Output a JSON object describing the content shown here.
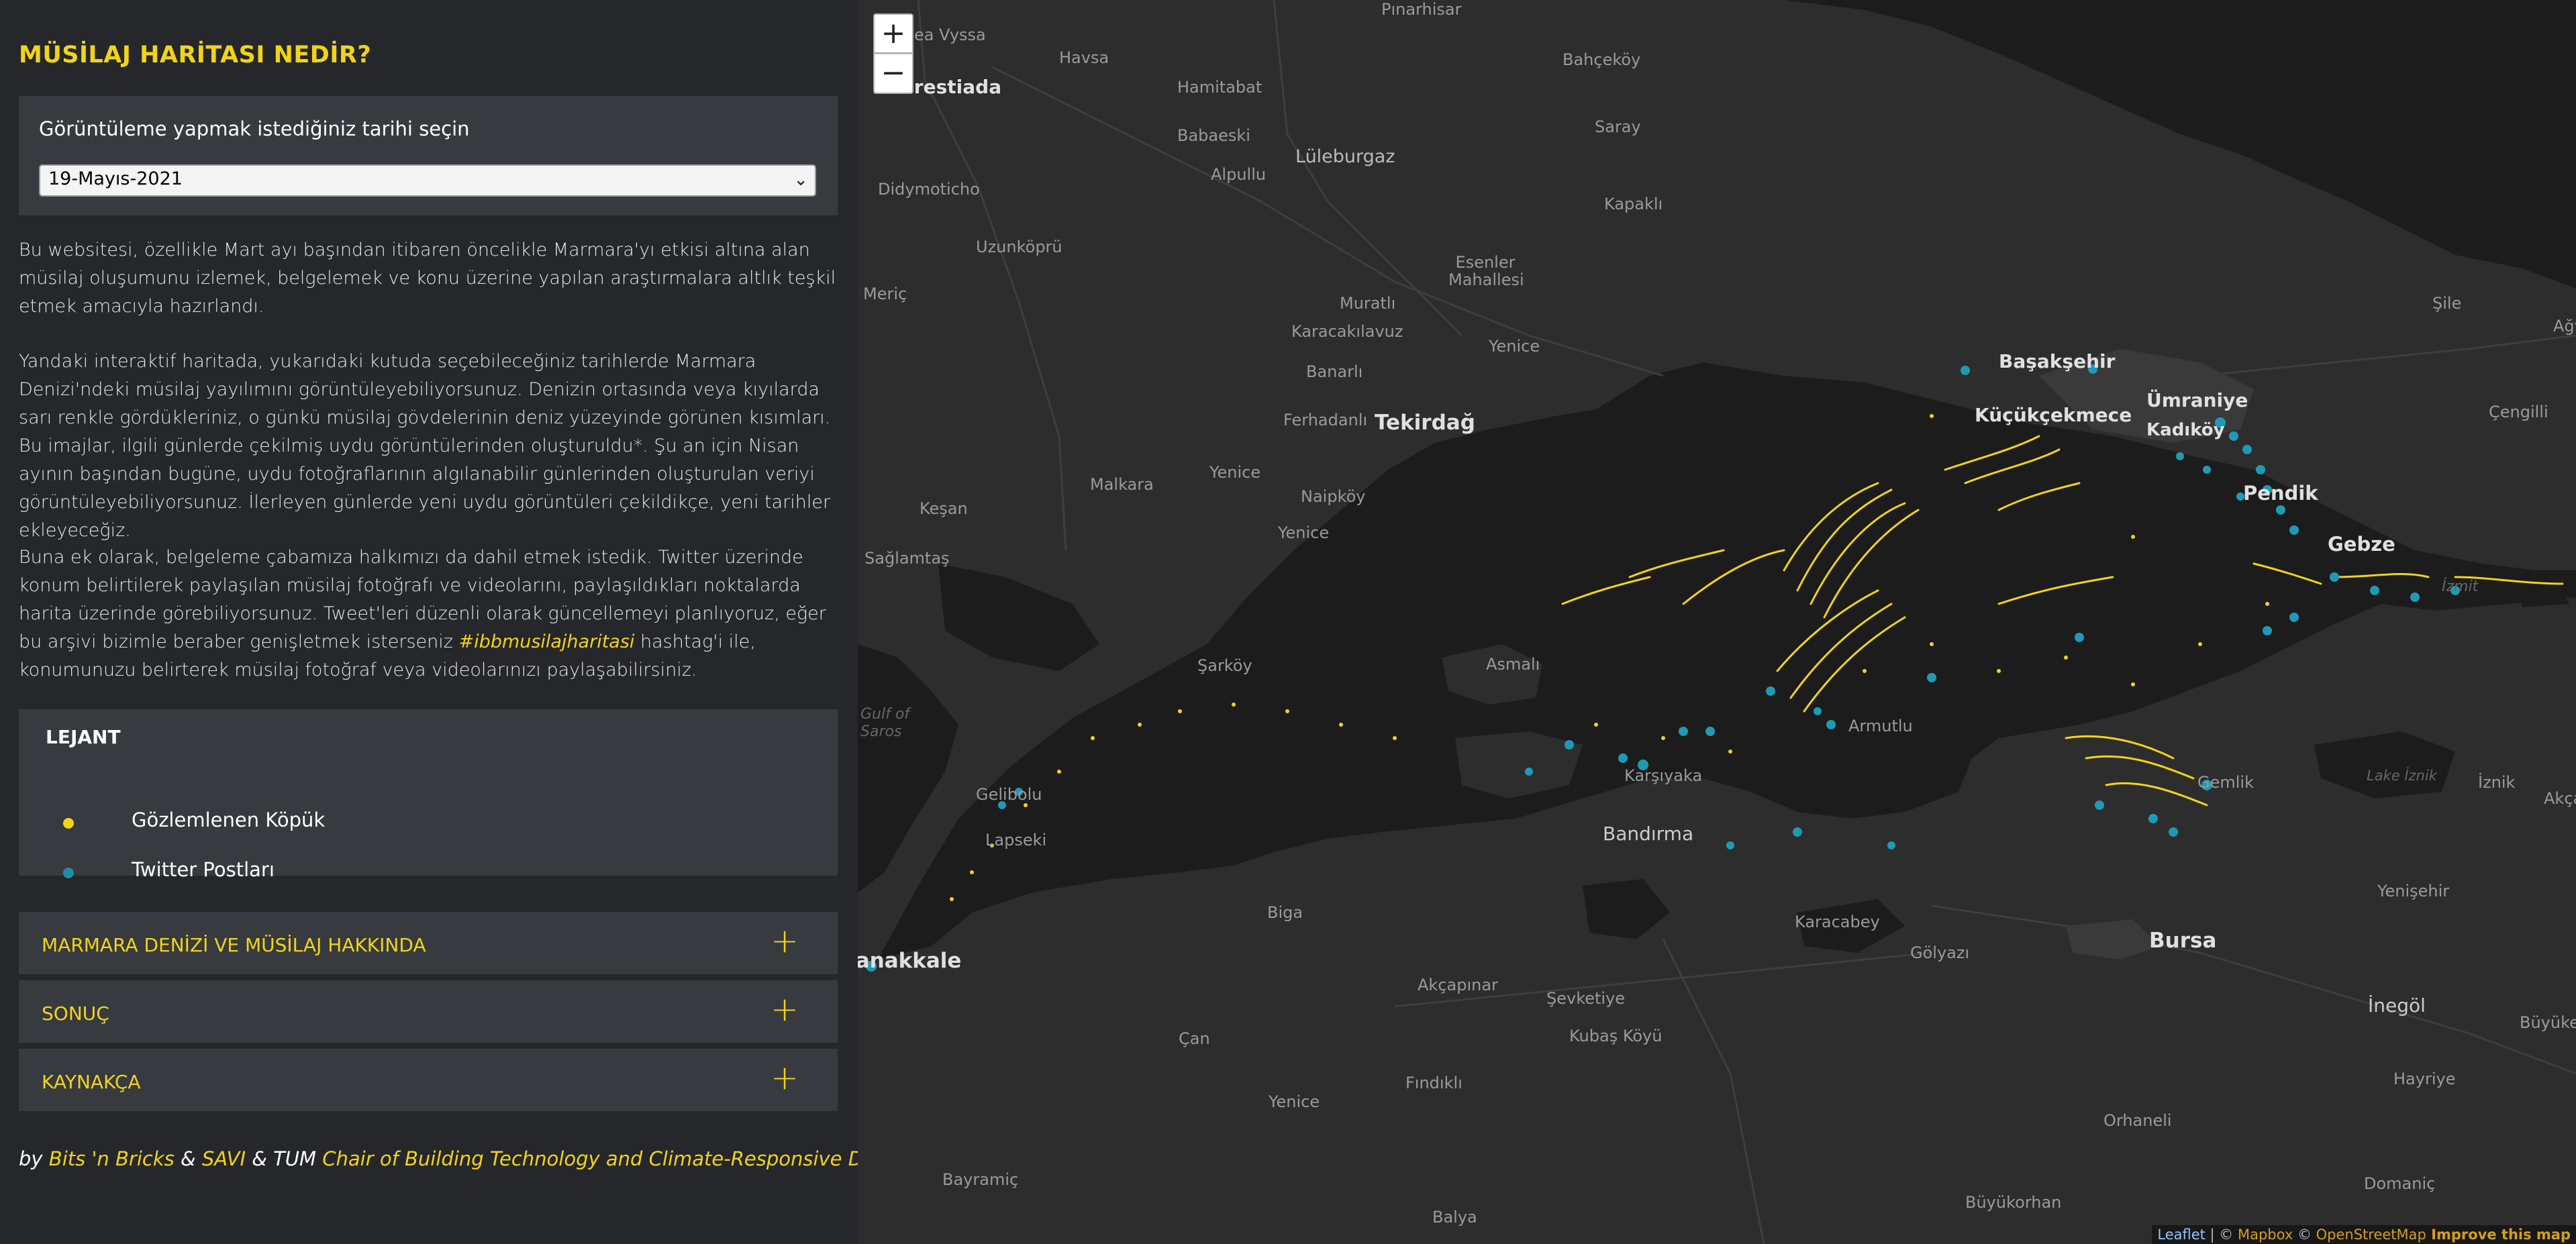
{
  "sidebar": {
    "title": "MÜSİLAJ HARİTASI NEDİR?",
    "date_prompt": "Görüntüleme yapmak istediğiniz tarihi seçin",
    "date_selected": "19-Mayıs-2021",
    "intro_1": "Bu websitesi, özellikle Mart ayı başından itibaren öncelikle Marmara'yı etkisi altına alan müsilaj oluşumunu izlemek, belgelemek ve konu üzerine yapılan araştırmalara altlık teşkil etmek amacıyla hazırlandı.",
    "intro_2": "Yandaki interaktif haritada, yukarıdaki kutuda seçebileceğiniz tarihlerde Marmara Denizi'ndeki müsilaj yayılımını görüntüleyebiliyorsunuz. Denizin ortasında veya kıyılarda sarı renkle gördükleriniz, o günkü müsilaj gövdelerinin deniz yüzeyinde görünen kısımları. Bu imajlar, ilgili günlerde çekilmiş uydu görüntülerinden oluşturuldu*. Şu an için Nisan ayının başından bugüne, uydu fotoğraflarının algılanabilir günlerinden oluşturulan veriyi görüntüleyebiliyorsunuz. İlerleyen günlerde yeni uydu görüntüleri çekildikçe, yeni tarihler ekleyeceğiz.",
    "intro_3_a": "Buna ek olarak, belgeleme çabamıza halkımızı da dahil etmek istedik. Twitter üzerinde konum belirtilerek paylaşılan müsilaj fotoğrafı ve videolarını, paylaşıldıkları noktalarda harita üzerinde görebiliyorsunuz. Tweet'leri düzenli olarak güncellemeyi planlıyoruz, eğer bu arşivi bizimle beraber genişletmek isterseniz ",
    "intro_3_hashtag": "#ibbmusilajharitasi",
    "intro_3_b": " hashtag'i ile, konumunuzu belirterek müsilaj fotoğraf veya videolarınızı paylaşabilirsiniz.",
    "legend": {
      "title": "LEJANT",
      "items": [
        {
          "label": "Gözlemlenen Köpük",
          "color": "#f2d417"
        },
        {
          "label": "Twitter Postları",
          "color": "#1f8fa8"
        }
      ]
    },
    "accordion": [
      {
        "label": "MARMARA DENİZİ VE MÜSİLAJ HAKKINDA",
        "icon": "plus-icon"
      },
      {
        "label": "SONUÇ",
        "icon": "plus-icon"
      },
      {
        "label": "KAYNAKÇA",
        "icon": "plus-icon"
      }
    ],
    "byline": {
      "by": "by ",
      "org1": "Bits 'n Bricks",
      "amp1": " & ",
      "org2": "SAVI",
      "amp2": " & TUM ",
      "org3": "Chair of Building Technology and Climate-Responsive Design"
    }
  },
  "map": {
    "zoom_in": "+",
    "zoom_out": "−",
    "attribution": {
      "leaflet": "Leaflet",
      "sep": " | © ",
      "mapbox": "Mapbox",
      "osm_prefix": " © ",
      "osm": "OpenStreetMap",
      "improve": " Improve this map"
    },
    "colors": {
      "land": "#2d2d2d",
      "water": "#1c1c1c",
      "mucilage": "#f2d417",
      "tweets": "#1f9ab5",
      "roads": "#3b3b3b"
    },
    "places": [
      {
        "name": "Pınarhisar",
        "big": false
      },
      {
        "name": "Havsa",
        "big": false
      },
      {
        "name": "Bahçeköy",
        "big": false
      },
      {
        "name": "Hamitabat",
        "big": false
      },
      {
        "name": "Nea Vyssa",
        "big": false
      },
      {
        "name": "Orestiada",
        "big": false
      },
      {
        "name": "Babaeski",
        "big": false
      },
      {
        "name": "Saray",
        "big": false
      },
      {
        "name": "Alpullu",
        "big": false
      },
      {
        "name": "Lüleburgaz",
        "big": false
      },
      {
        "name": "Didymoticho",
        "big": false
      },
      {
        "name": "Kapaklı",
        "big": false
      },
      {
        "name": "Uzunköprü",
        "big": false
      },
      {
        "name": "Esenler Mahallesi",
        "big": false
      },
      {
        "name": "Meriç",
        "big": false
      },
      {
        "name": "Muratlı",
        "big": false
      },
      {
        "name": "Şile",
        "big": false
      },
      {
        "name": "Karacakılavuz",
        "big": false
      },
      {
        "name": "Yenice",
        "big": false
      },
      {
        "name": "Banarlı",
        "big": false
      },
      {
        "name": "Başakşehir",
        "big": true
      },
      {
        "name": "Ümraniye",
        "big": true
      },
      {
        "name": "Ağva",
        "big": false
      },
      {
        "name": "Küçükçekmece",
        "big": true
      },
      {
        "name": "Ferhadanlı",
        "big": false
      },
      {
        "name": "Tekirdağ",
        "big": true
      },
      {
        "name": "Kadıköy",
        "big": true
      },
      {
        "name": "Çengilli",
        "big": false
      },
      {
        "name": "Yenice",
        "big": false
      },
      {
        "name": "Malkara",
        "big": false
      },
      {
        "name": "Naipköy",
        "big": false
      },
      {
        "name": "Pendik",
        "big": true
      },
      {
        "name": "Keşan",
        "big": false
      },
      {
        "name": "Yenice",
        "big": false
      },
      {
        "name": "Gebze",
        "big": true
      },
      {
        "name": "Sağlamtaş",
        "big": false
      },
      {
        "name": "Asmalı",
        "big": false
      },
      {
        "name": "Şarköy",
        "big": false
      },
      {
        "name": "İzmit",
        "big": false
      },
      {
        "name": "Armutlu",
        "big": false
      },
      {
        "name": "Lake İznik",
        "big": false
      },
      {
        "name": "Karşıyaka",
        "big": false
      },
      {
        "name": "Gemlik",
        "big": false
      },
      {
        "name": "İznik",
        "big": false
      },
      {
        "name": "Akça",
        "big": false
      },
      {
        "name": "Gelibolu",
        "big": false
      },
      {
        "name": "Lapseki",
        "big": false
      },
      {
        "name": "Bandırma",
        "big": true
      },
      {
        "name": "Yenişehir",
        "big": false
      },
      {
        "name": "Biga",
        "big": false
      },
      {
        "name": "Karacabey",
        "big": false
      },
      {
        "name": "Bursa",
        "big": true
      },
      {
        "name": "Gölyazı",
        "big": false
      },
      {
        "name": "Çanakkale",
        "big": true
      },
      {
        "name": "Akçapınar",
        "big": false
      },
      {
        "name": "Şevketiye",
        "big": false
      },
      {
        "name": "İnegöl",
        "big": true
      },
      {
        "name": "Kubaş Köyü",
        "big": false
      },
      {
        "name": "Büyükelma",
        "big": false
      },
      {
        "name": "Çan",
        "big": false
      },
      {
        "name": "Fındıklı",
        "big": false
      },
      {
        "name": "Hayriye",
        "big": false
      },
      {
        "name": "Yenice",
        "big": false
      },
      {
        "name": "Orhaneli",
        "big": false
      },
      {
        "name": "Bayramiç",
        "big": false
      },
      {
        "name": "Domaniç",
        "big": false
      },
      {
        "name": "Balya",
        "big": false
      },
      {
        "name": "Büyükorhan",
        "big": false
      },
      {
        "name": "Gulf of Saros",
        "big": false
      }
    ]
  }
}
